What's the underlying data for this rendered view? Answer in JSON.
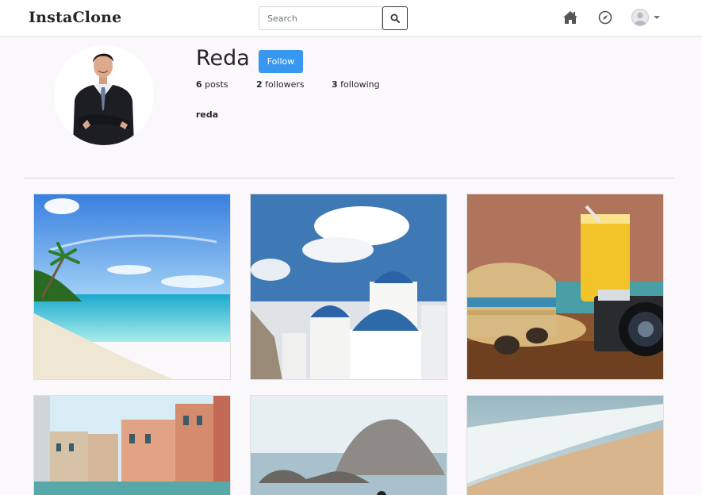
{
  "navbar": {
    "brand": "InstaClone",
    "search": {
      "placeholder": "Search",
      "value": ""
    },
    "icons": [
      "search-icon",
      "home-icon",
      "compass-icon",
      "user-avatar-icon",
      "caret-down-icon"
    ]
  },
  "profile": {
    "username": "Reda",
    "follow_label": "Follow",
    "stats": {
      "posts_count": "6",
      "posts_label": "posts",
      "followers_count": "2",
      "followers_label": "followers",
      "following_count": "3",
      "following_label": "following"
    },
    "bio_name": "reda"
  },
  "posts": [
    {
      "name": "tropical-beach"
    },
    {
      "name": "santorini-domes"
    },
    {
      "name": "straw-hat-camera-juice"
    },
    {
      "name": "venice-canal"
    },
    {
      "name": "rocky-island-sea"
    },
    {
      "name": "sandy-beach-wave"
    }
  ],
  "colors": {
    "accent": "#3897f0",
    "background": "#fbf8fc",
    "text": "#262626"
  }
}
